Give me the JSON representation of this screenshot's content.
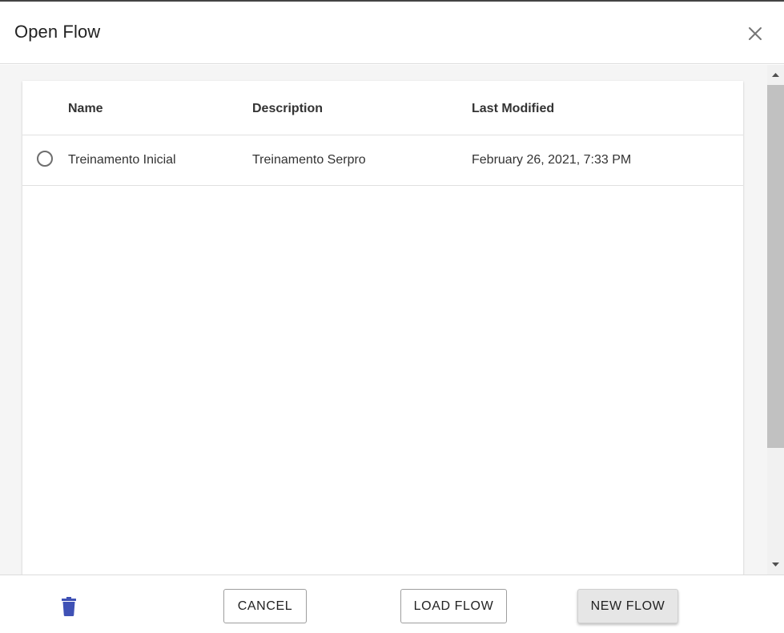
{
  "dialog": {
    "title": "Open Flow",
    "close_icon": "close-icon"
  },
  "table": {
    "columns": [
      "Name",
      "Description",
      "Last Modified"
    ],
    "rows": [
      {
        "name": "Treinamento Inicial",
        "description": "Treinamento Serpro",
        "last_modified": "February 26, 2021, 7:33 PM",
        "selected": false
      }
    ]
  },
  "footer": {
    "delete_icon": "trash-icon",
    "cancel_label": "CANCEL",
    "load_label": "LOAD FLOW",
    "new_label": "NEW FLOW"
  },
  "colors": {
    "accent": "#3f51b5",
    "radio_border": "#6e6e6e",
    "scroll_thumb": "#c1c1c1"
  }
}
